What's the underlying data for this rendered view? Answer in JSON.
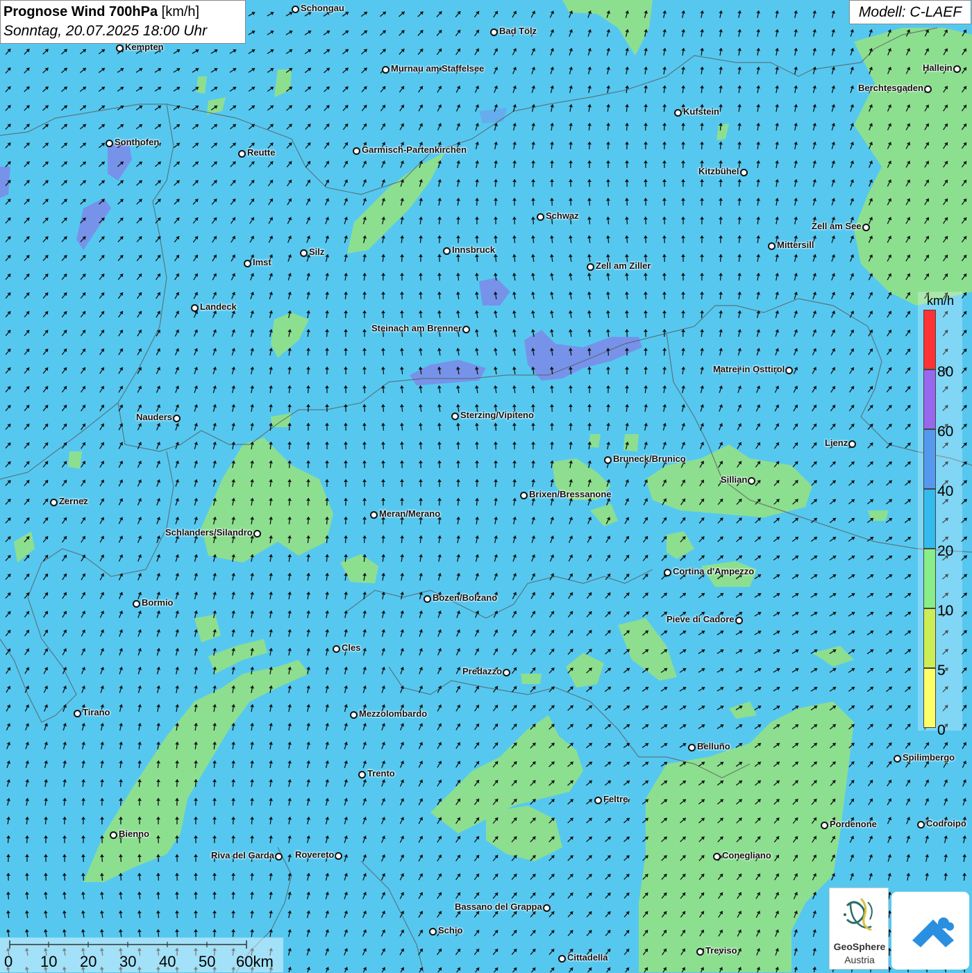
{
  "header": {
    "title_bold": "Prognose Wind 700hPa",
    "title_unit": " [km/h]",
    "subtitle": "Sonntag, 20.07.2025 18:00 Uhr",
    "model": "Modell: C-LAEF"
  },
  "legend": {
    "unit": "km/h",
    "bins": [
      {
        "label": "80",
        "color": "#ff3333"
      },
      {
        "label": "60",
        "color": "#9966ee"
      },
      {
        "label": "40",
        "color": "#5599ee"
      },
      {
        "label": "20",
        "color": "#33bbee"
      },
      {
        "label": "10",
        "color": "#88ee88"
      },
      {
        "label": "5",
        "color": "#ccee55"
      },
      {
        "label": "0",
        "color": "#ffff66"
      }
    ],
    "top_color": "#ff3333"
  },
  "scale_bar": {
    "labels": [
      "0",
      "10",
      "20",
      "30",
      "40",
      "50",
      "60km"
    ]
  },
  "logo": {
    "name": "GeoSphere",
    "sub": "Austria",
    "icon": "geosphere-logo-icon",
    "app_icon": "wind-app-icon"
  },
  "colors": {
    "background": "#56c8f0",
    "calm_area": "#90e08a",
    "strong_area": "#7a8de8"
  },
  "cities": [
    {
      "name": "Schongau"
    },
    {
      "name": "Bad Tölz"
    },
    {
      "name": "Kempten"
    },
    {
      "name": "Murnau am Staffelsee"
    },
    {
      "name": "Hallein"
    },
    {
      "name": "Berchtesgaden"
    },
    {
      "name": "Kufstein"
    },
    {
      "name": "Sonthofen"
    },
    {
      "name": "Reutte"
    },
    {
      "name": "Garmisch-Partenkirchen"
    },
    {
      "name": "Kitzbühel"
    },
    {
      "name": "Schwaz"
    },
    {
      "name": "Zell am See"
    },
    {
      "name": "Mittersill"
    },
    {
      "name": "Imst"
    },
    {
      "name": "Silz"
    },
    {
      "name": "Innsbruck"
    },
    {
      "name": "Zell am Ziller"
    },
    {
      "name": "Landeck"
    },
    {
      "name": "Steinach am Brenner"
    },
    {
      "name": "Matrei in Osttirol"
    },
    {
      "name": "Nauders"
    },
    {
      "name": "Sterzing/Vipiteno"
    },
    {
      "name": "Lienz"
    },
    {
      "name": "Bruneck/Brunico"
    },
    {
      "name": "Sillian"
    },
    {
      "name": "Zernez"
    },
    {
      "name": "Brixen/Bressanone"
    },
    {
      "name": "Meran/Merano"
    },
    {
      "name": "Schlanders/Silandro"
    },
    {
      "name": "Cortina d'Ampezzo"
    },
    {
      "name": "Bozen/Bolzano"
    },
    {
      "name": "Bormio"
    },
    {
      "name": "Pieve di Cadore"
    },
    {
      "name": "Cles"
    },
    {
      "name": "Predazzo"
    },
    {
      "name": "Tirano"
    },
    {
      "name": "Mezzolombardo"
    },
    {
      "name": "Belluno"
    },
    {
      "name": "Spilimbergo"
    },
    {
      "name": "Trento"
    },
    {
      "name": "Feltre"
    },
    {
      "name": "Pordenone"
    },
    {
      "name": "Codroipo"
    },
    {
      "name": "Bienno"
    },
    {
      "name": "Riva del Garda"
    },
    {
      "name": "Rovereto"
    },
    {
      "name": "Conegliano"
    },
    {
      "name": "Bassano del Grappa"
    },
    {
      "name": "Schio"
    },
    {
      "name": "Treviso"
    },
    {
      "name": "Cittadella"
    }
  ]
}
